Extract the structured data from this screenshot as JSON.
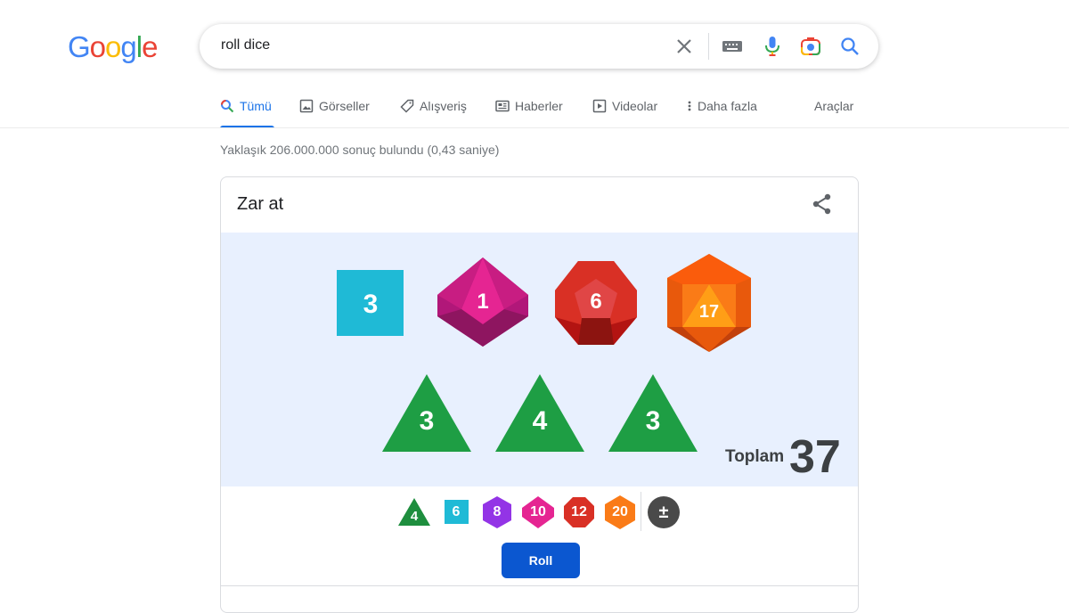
{
  "logo": {
    "text": "Google",
    "letters": [
      "G",
      "o",
      "o",
      "g",
      "l",
      "e"
    ],
    "colors": [
      "#4285F4",
      "#EA4335",
      "#FBBC05",
      "#4285F4",
      "#34A853",
      "#EA4335"
    ]
  },
  "search": {
    "query": "roll dice",
    "icons": [
      "clear-icon",
      "keyboard-icon",
      "mic-icon",
      "camera-lens-icon",
      "search-icon"
    ]
  },
  "tabs": [
    {
      "label": "Tümü",
      "icon": "search-icon",
      "active": true
    },
    {
      "label": "Görseller",
      "icon": "image-icon",
      "active": false
    },
    {
      "label": "Alışveriş",
      "icon": "tag-icon",
      "active": false
    },
    {
      "label": "Haberler",
      "icon": "news-icon",
      "active": false
    },
    {
      "label": "Videolar",
      "icon": "play-icon",
      "active": false
    },
    {
      "label": "Daha fazla",
      "icon": "more-vert-icon",
      "active": false
    }
  ],
  "tools_label": "Araçlar",
  "result_stats": "Yaklaşık 206.000.000 sonuç bulundu (0,43 saniye)",
  "card": {
    "title": "Zar at",
    "rolled_dice": [
      {
        "type": "d6",
        "value": "3",
        "color": "#1fbad6"
      },
      {
        "type": "d10",
        "value": "1",
        "color": "#e52592"
      },
      {
        "type": "d12",
        "value": "6",
        "color": "#d93025"
      },
      {
        "type": "d20",
        "value": "17",
        "color": "#fa7b17"
      },
      {
        "type": "d4",
        "value": "3",
        "color": "#1e8e3e"
      },
      {
        "type": "d4",
        "value": "4",
        "color": "#1e8e3e"
      },
      {
        "type": "d4",
        "value": "3",
        "color": "#1e8e3e"
      }
    ],
    "total_label": "Toplam",
    "total_value": "37",
    "picker": [
      {
        "sides": "4",
        "color": "#1e8e3e"
      },
      {
        "sides": "6",
        "color": "#1fbad6"
      },
      {
        "sides": "8",
        "color": "#9334e6"
      },
      {
        "sides": "10",
        "color": "#e52592"
      },
      {
        "sides": "12",
        "color": "#d93025"
      },
      {
        "sides": "20",
        "color": "#fa7b17"
      },
      {
        "sides": "±",
        "color": "#4a4a4a"
      }
    ],
    "roll_label": "Roll"
  }
}
